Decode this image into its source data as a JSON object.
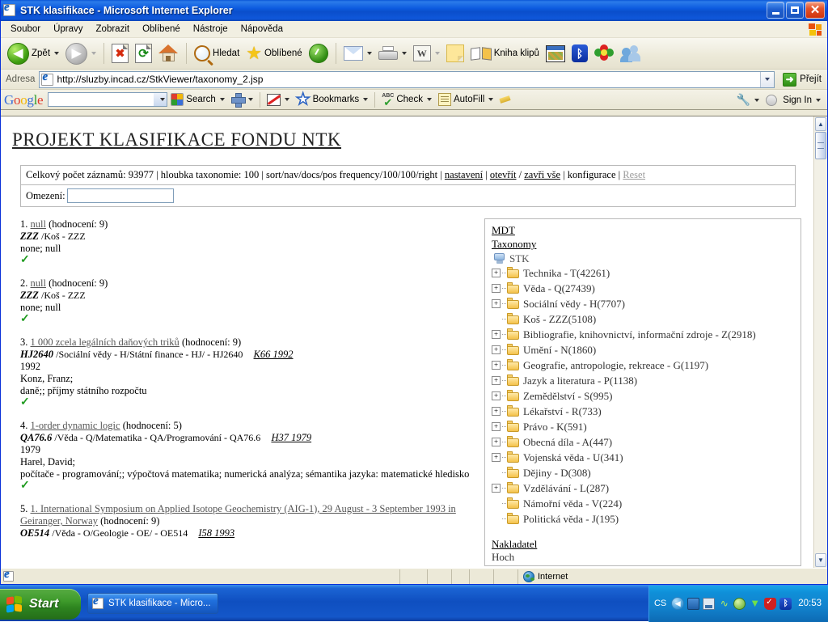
{
  "window": {
    "title": "STK klasifikace - Microsoft Internet Explorer",
    "icon": "ie-icon",
    "minimize_label": "Minimize",
    "maximize_label": "Maximize",
    "close_label": "Close"
  },
  "menu": [
    "Soubor",
    "Úpravy",
    "Zobrazit",
    "Oblíbené",
    "Nástroje",
    "Nápověda"
  ],
  "toolbar": {
    "back": "Zpět",
    "forward": "",
    "stop": "",
    "refresh": "",
    "home": "",
    "search": "Hledat",
    "favorites": "Oblíbené",
    "history": "",
    "mail": "",
    "print": "",
    "edit": "",
    "notes": "",
    "clipbook": "Kniha klipů",
    "capture": "",
    "bluetooth": "",
    "icq": "",
    "messenger": ""
  },
  "address": {
    "label": "Adresa",
    "url": "http://sluzby.incad.cz/StkViewer/taxonomy_2.jsp",
    "go_label": "Přejít"
  },
  "google_toolbar": {
    "logo": "Google",
    "search_value": "",
    "search_label": "Search",
    "popup_blocker": "",
    "bookmarks_label": "Bookmarks",
    "check_label": "Check",
    "autofill_label": "AutoFill",
    "highlight": "",
    "settings": "",
    "sign_in_label": "Sign In"
  },
  "page": {
    "title": "PROJEKT KLASIFIKACE FONDU NTK",
    "info_line": {
      "total_label": "Celkový počet záznamů: 93977",
      "depth_label": "hloubka taxonomie: 100",
      "sort_label": "sort/nav/docs/pos frequency/100/100/right",
      "links": [
        {
          "text": "nastavení",
          "state": "active"
        },
        {
          "text": "otevřít",
          "state": "active"
        },
        {
          "text": "zavři vše",
          "state": "active"
        },
        {
          "text": "konfigurace",
          "state": "plain"
        },
        {
          "text": "Reset",
          "state": "disabled"
        }
      ],
      "separator": "|",
      "slash": "/"
    },
    "filter": {
      "label": "Omezení:",
      "value": "",
      "placeholder": ""
    },
    "records": [
      {
        "num": "1.",
        "title": "null",
        "score": "(hodnocení: 9)",
        "code": "ZZZ",
        "path": "/Koš - ZZZ",
        "signature": "",
        "year": "",
        "author": "",
        "keywords": "none; null",
        "check": "✓"
      },
      {
        "num": "2.",
        "title": "null",
        "score": "(hodnocení: 9)",
        "code": "ZZZ",
        "path": "/Koš - ZZZ",
        "signature": "",
        "year": "",
        "author": "",
        "keywords": "none; null",
        "check": "✓"
      },
      {
        "num": "3.",
        "title": "1 000 zcela legálních daňových triků",
        "score": "(hodnocení: 9)",
        "code": "HJ2640",
        "path": "/Sociální vědy - H/Státní finance - HJ/ - HJ2640",
        "signature": "K66 1992",
        "year": "1992",
        "author": "Konz, Franz;",
        "keywords": "daně;; příjmy státního rozpočtu",
        "check": "✓"
      },
      {
        "num": "4.",
        "title": "1-order dynamic logic",
        "score": "(hodnocení: 5)",
        "code": "QA76.6",
        "path": "/Věda - Q/Matematika - QA/Programování - QA76.6",
        "signature": "H37 1979",
        "year": "1979",
        "author": "Harel, David;",
        "keywords": "počítače - programování;; výpočtová matematika; numerická analýza; sémantika jazyka: matematické hledisko",
        "check": "✓"
      },
      {
        "num": "5.",
        "title": "1. International Symposium on Applied Isotope Geochemistry (AIG-1), 29 August - 3 September 1993 in Geiranger, Norway",
        "score": "(hodnocení: 9)",
        "code": "OE514",
        "path": "/Věda - O/Geologie - OE/ - OE514",
        "signature": "I58 1993",
        "year": "",
        "author": "",
        "keywords": "",
        "check": ""
      }
    ],
    "tree": {
      "header1": "MDT",
      "header2": "Taxonomy",
      "root": "STK",
      "nodes": [
        {
          "label": "Technika - T(42261)",
          "expandable": true
        },
        {
          "label": "Věda - Q(27439)",
          "expandable": true
        },
        {
          "label": "Sociální vědy - H(7707)",
          "expandable": true
        },
        {
          "label": "Koš - ZZZ(5108)",
          "expandable": false
        },
        {
          "label": "Bibliografie, knihovnictví, informační zdroje - Z(2918)",
          "expandable": true
        },
        {
          "label": "Umění - N(1860)",
          "expandable": true
        },
        {
          "label": "Geografie, antropologie, rekreace - G(1197)",
          "expandable": true
        },
        {
          "label": "Jazyk a literatura - P(1138)",
          "expandable": true
        },
        {
          "label": "Zemědělství - S(995)",
          "expandable": true
        },
        {
          "label": "Lékařství - R(733)",
          "expandable": true
        },
        {
          "label": "Právo - K(591)",
          "expandable": true
        },
        {
          "label": "Obecná díla - A(447)",
          "expandable": true
        },
        {
          "label": "Vojenská věda - U(341)",
          "expandable": true
        },
        {
          "label": "Dějiny - D(308)",
          "expandable": false
        },
        {
          "label": "Vzdělávání - L(287)",
          "expandable": true
        },
        {
          "label": "Námořní věda - V(224)",
          "expandable": false
        },
        {
          "label": "Politická věda - J(195)",
          "expandable": false
        }
      ],
      "footer1": "Nakladatel",
      "footer2": "Hoch"
    }
  },
  "status_bar": {
    "zone": "Internet"
  },
  "taskbar": {
    "start": "Start",
    "items": [
      {
        "label": "STK klasifikace - Micro...",
        "icon": "ie-icon"
      }
    ],
    "tray": {
      "language": "CS",
      "clock": "20:53"
    }
  },
  "colors": {
    "title_blue": "#0a4ecb",
    "taskbar_blue": "#1b64d4",
    "start_green": "#3e9a2b",
    "check_green": "#1f9b1f",
    "folder_yellow": "#f4c24a",
    "link_gray": "#555555"
  }
}
